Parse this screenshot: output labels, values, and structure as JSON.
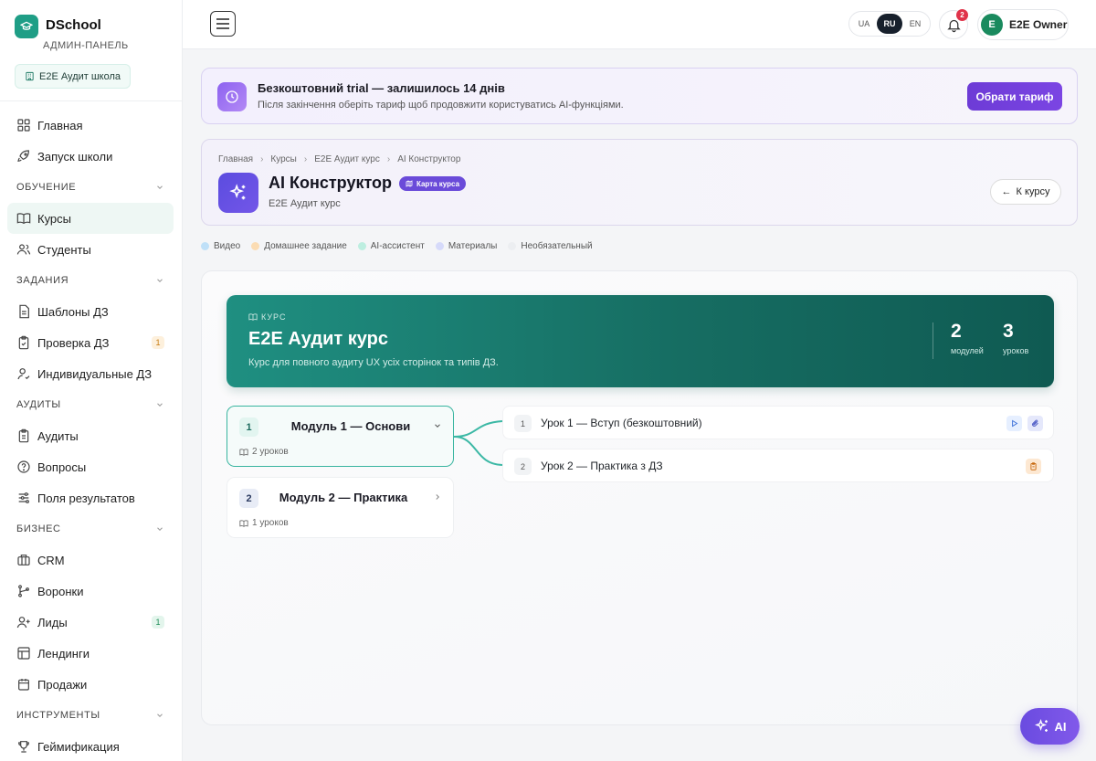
{
  "brand": {
    "name": "DSchool",
    "subtitle": "АДМИН-ПАНЕЛЬ",
    "school": "E2E Аудит школа"
  },
  "sidebar": {
    "items": [
      {
        "label": "Главная",
        "icon": "grid-icon"
      },
      {
        "label": "Запуск школи",
        "icon": "rocket-icon"
      },
      {
        "section": "ОБУЧЕНИЕ"
      },
      {
        "label": "Курсы",
        "icon": "book-icon",
        "active": true
      },
      {
        "label": "Студенты",
        "icon": "users-icon"
      },
      {
        "section": "ЗАДАНИЯ"
      },
      {
        "label": "Шаблоны ДЗ",
        "icon": "document-icon"
      },
      {
        "label": "Проверка ДЗ",
        "icon": "clipboard-check-icon",
        "badge": "1"
      },
      {
        "label": "Индивидуальные ДЗ",
        "icon": "user-task-icon"
      },
      {
        "section": "АУДИТЫ"
      },
      {
        "label": "Аудиты",
        "icon": "clipboard-icon"
      },
      {
        "label": "Вопросы",
        "icon": "question-icon"
      },
      {
        "label": "Поля результатов",
        "icon": "sliders-icon"
      },
      {
        "section": "БИЗНЕС"
      },
      {
        "label": "CRM",
        "icon": "briefcase-icon"
      },
      {
        "label": "Воронки",
        "icon": "funnel-icon"
      },
      {
        "label": "Лиды",
        "icon": "user-plus-icon",
        "badge": "1"
      },
      {
        "label": "Лендинги",
        "icon": "layout-icon"
      },
      {
        "label": "Продажи",
        "icon": "receipt-icon"
      },
      {
        "section": "ИНСТРУМЕНТЫ"
      },
      {
        "label": "Геймификация",
        "icon": "trophy-icon"
      }
    ]
  },
  "topbar": {
    "languages": [
      {
        "code": "UA",
        "active": false
      },
      {
        "code": "RU",
        "active": true
      },
      {
        "code": "EN",
        "active": false
      }
    ],
    "notifications_count": "2",
    "user": {
      "initial": "E",
      "name": "E2E Owner"
    }
  },
  "trial": {
    "title": "Безкоштовний trial — залишилось 14 днів",
    "subtitle": "Після закінчення оберіть тариф щоб продовжити користуватись AI-функціями.",
    "button": "Обрати тариф"
  },
  "header": {
    "breadcrumbs": [
      "Главная",
      "Курсы",
      "E2E Аудит курс",
      "AI Конструктор"
    ],
    "title": "AI Конструктор",
    "badge": "Карта курса",
    "subtitle": "E2E Аудит курс",
    "back_button": "К курсу"
  },
  "legend": [
    {
      "label": "Видео",
      "color": "#bfe0f8"
    },
    {
      "label": "Домашнее задание",
      "color": "#fbdcb3"
    },
    {
      "label": "AI-ассистент",
      "color": "#bdeee0"
    },
    {
      "label": "Материалы",
      "color": "#d6dafa"
    },
    {
      "label": "Необязательный",
      "color": "#eceef1"
    }
  ],
  "course": {
    "tag": "КУРС",
    "title": "E2E Аудит курс",
    "description": "Курс для повного аудиту UX усіх сторінок та типів ДЗ.",
    "modules_count": "2",
    "modules_label": "модулей",
    "lessons_count": "3",
    "lessons_label": "уроков"
  },
  "modules": [
    {
      "number": "1",
      "title": "Модуль 1 — Основи",
      "lessons": "2 уроков",
      "expanded": true
    },
    {
      "number": "2",
      "title": "Модуль 2 — Практика",
      "lessons": "1 уроков",
      "expanded": false
    }
  ],
  "lessons": [
    {
      "number": "1",
      "title": "Урок 1 — Вступ (безкоштовний)",
      "icons": [
        "video-icon",
        "paperclip-icon"
      ]
    },
    {
      "number": "2",
      "title": "Урок 2 — Практика з ДЗ",
      "icons": [
        "homework-icon"
      ]
    }
  ],
  "ai_button": "AI",
  "colors": {
    "accent": "#1f9e86",
    "brand_purple": "#6d3bd6",
    "course_teal": "#166d62"
  }
}
